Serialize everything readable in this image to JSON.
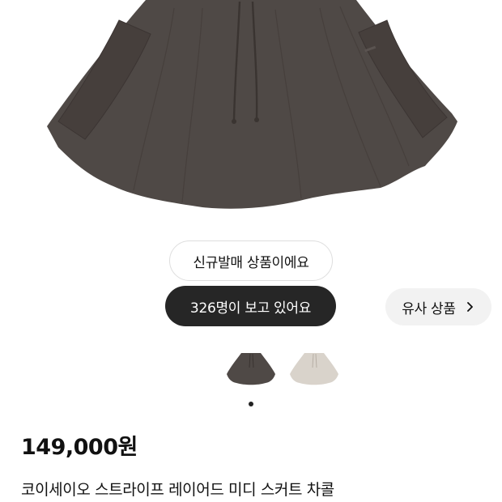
{
  "product": {
    "badge_new": "신규발매 상품이에요",
    "viewers": "326명이 보고 있어요",
    "similar_label": "유사 상품",
    "price": "149,000원",
    "title": "코이세이오 스트라이프 레이어드 미디 스커트 차콜"
  },
  "gallery": {
    "current_image": 1,
    "image_count": 1,
    "color_options": [
      {
        "name": "charcoal",
        "color": "#4f4946"
      },
      {
        "name": "ivory",
        "color": "#d9d3cb"
      }
    ]
  },
  "icons": {
    "similar_arrow": "chevron-right-icon",
    "pagination": "dot-indicator"
  },
  "colors": {
    "skirt_charcoal": "#4f4946",
    "skirt_ivory": "#d9d3cb",
    "dark_pill": "#262626"
  }
}
